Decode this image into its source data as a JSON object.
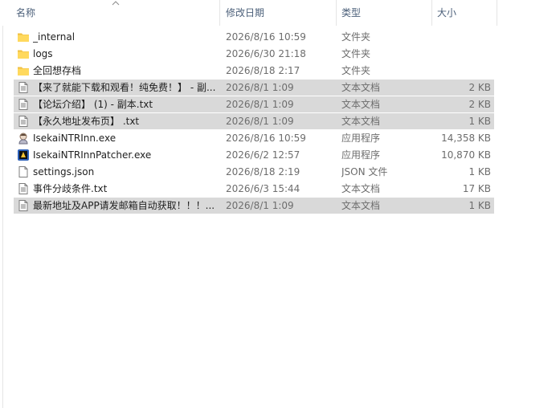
{
  "columns": {
    "name": "名称",
    "date": "修改日期",
    "type": "类型",
    "size": "大小"
  },
  "files": [
    {
      "name": "_internal",
      "date": "2026/8/16 10:59",
      "type": "文件夹",
      "size": "",
      "icon": "folder-icon",
      "selected": false
    },
    {
      "name": "logs",
      "date": "2026/6/30 21:18",
      "type": "文件夹",
      "size": "",
      "icon": "folder-icon",
      "selected": false
    },
    {
      "name": "全回想存档",
      "date": "2026/8/18 2:17",
      "type": "文件夹",
      "size": "",
      "icon": "folder-icon",
      "selected": false
    },
    {
      "name": "【来了就能下载和观看！纯免费！】 - 副...",
      "date": "2026/8/1 1:09",
      "type": "文本文档",
      "size": "2 KB",
      "icon": "text-file-icon",
      "selected": true
    },
    {
      "name": "【论坛介绍】 (1) - 副本.txt",
      "date": "2026/8/1 1:09",
      "type": "文本文档",
      "size": "2 KB",
      "icon": "text-file-icon",
      "selected": true
    },
    {
      "name": "【永久地址发布页】 .txt",
      "date": "2026/8/1 1:09",
      "type": "文本文档",
      "size": "1 KB",
      "icon": "text-file-icon",
      "selected": true
    },
    {
      "name": "IsekaiNTRInn.exe",
      "date": "2026/8/16 10:59",
      "type": "应用程序",
      "size": "14,358 KB",
      "icon": "app-character-icon",
      "selected": false
    },
    {
      "name": "IsekaiNTRInnPatcher.exe",
      "date": "2026/6/2 12:57",
      "type": "应用程序",
      "size": "10,870 KB",
      "icon": "patcher-app-icon",
      "selected": false
    },
    {
      "name": "settings.json",
      "date": "2026/8/18 2:19",
      "type": "JSON 文件",
      "size": "1 KB",
      "icon": "blank-file-icon",
      "selected": false
    },
    {
      "name": "事件分歧条件.txt",
      "date": "2026/6/3 15:44",
      "type": "文本文档",
      "size": "17 KB",
      "icon": "text-file-icon",
      "selected": false
    },
    {
      "name": "最新地址及APP请发邮箱自动获取！！！...",
      "date": "2026/8/1 1:09",
      "type": "文本文档",
      "size": "1 KB",
      "icon": "text-file-icon",
      "selected": true
    }
  ]
}
